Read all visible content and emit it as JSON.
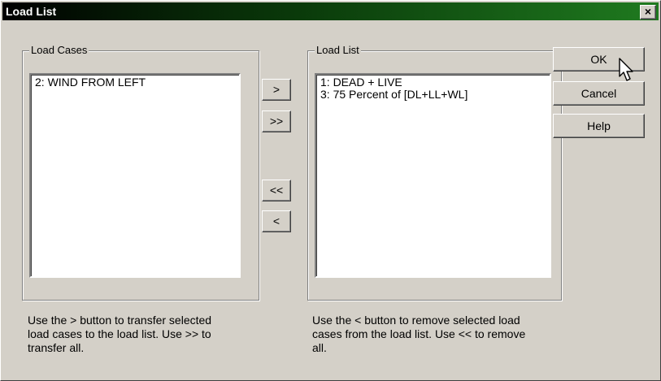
{
  "window": {
    "title": "Load List",
    "close_glyph": "×"
  },
  "load_cases": {
    "group_label": "Load Cases",
    "items": [
      "2: WIND FROM LEFT"
    ],
    "hint": "Use the > button to transfer selected\nload cases to the load list. Use >> to\ntransfer all."
  },
  "load_list": {
    "group_label": "Load List",
    "items": [
      "1: DEAD + LIVE",
      "3: 75 Percent of [DL+LL+WL]"
    ],
    "hint": "Use the < button to remove selected load\ncases from the load list. Use << to remove\nall."
  },
  "transfer_buttons": {
    "add": ">",
    "add_all": ">>",
    "remove_all": "<<",
    "remove": "<"
  },
  "action_buttons": {
    "ok": "OK",
    "cancel": "Cancel",
    "help": "Help"
  },
  "icons": {
    "cursor": "arrow-cursor-icon"
  }
}
